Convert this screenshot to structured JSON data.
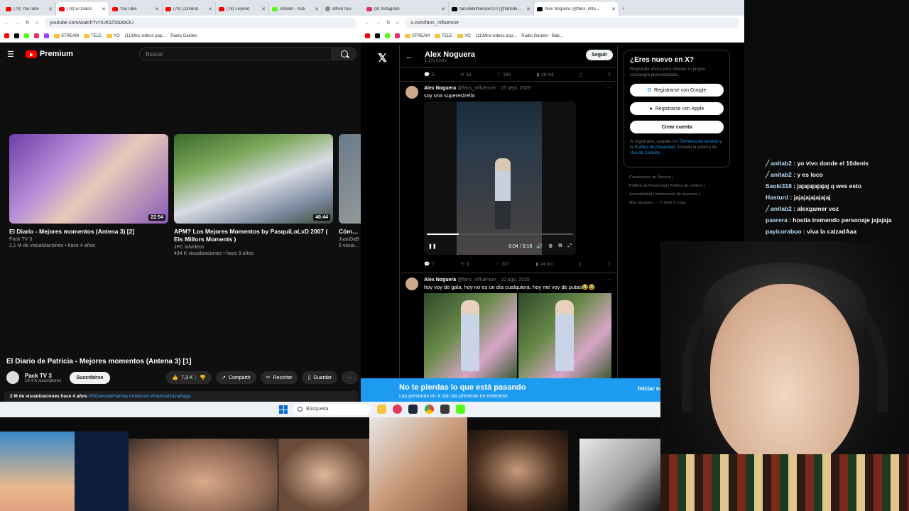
{
  "left_browser": {
    "tabs": [
      {
        "label": "(78) YouTube",
        "icon": "youtube"
      },
      {
        "label": "(78) El Diario",
        "icon": "youtube",
        "active": true
      },
      {
        "label": "YouTube",
        "icon": "youtube"
      },
      {
        "label": "(78) Comand",
        "icon": "youtube"
      },
      {
        "label": "(78) Leyend",
        "icon": "youtube"
      },
      {
        "label": "Stream - Kick",
        "icon": "kick"
      },
      {
        "label": "alfred neu",
        "icon": "globe"
      }
    ],
    "url": "youtube.com/watch?v=IUtOZSbAbOU",
    "bookmarks": [
      "STREAM",
      "TELE",
      "YO",
      "(11)Miru videos pop...",
      "Radio Garden"
    ],
    "header": {
      "logo": "Premium",
      "search_placeholder": "Buscar"
    },
    "end_cards": [
      {
        "title": "El Diario - Mejores momentos (Antena 3) [2]",
        "channel": "Pack TV 3",
        "meta": "2,1 M de visualizaciones • hace 4 años",
        "duration": "22:54"
      },
      {
        "title": "APM? Los Mejores Momentos by PasquiLoLxD 2007 ( Els Millors Moments )",
        "channel": "JPC lolvideos",
        "meta": "434 K visualizaciones • hace 9 años",
        "duration": "40:44"
      },
      {
        "title": "Cómo h Barriga",
        "channel": "JuanDaB",
        "meta": "5 visualiza",
        "duration": ""
      }
    ],
    "video": {
      "title": "El Diario de Patricia - Mejores momentos (Antena 3) [1]",
      "channel": "Pack TV 3",
      "subscribers": "19,4 K suscriptores",
      "subscribe_label": "Suscribirse",
      "likes": "7,3 K",
      "share_label": "Compartir",
      "clip_label": "Recortar",
      "save_label": "Guardar",
      "views": "2 M de visualizaciones  hace 4 años",
      "tags": "#ElDiariodePatricia #Antena3 #PatriciaGaztañaga"
    }
  },
  "right_browser": {
    "tabs": [
      {
        "label": "(9) Instagram"
      },
      {
        "label": "fansdelinfluencer3.0 (@fansde..."
      },
      {
        "label": "Alex Noguera (@fans_influ...",
        "active": true
      }
    ],
    "url": "x.com/fans_influencer",
    "bookmarks": [
      "STREAM",
      "TELE",
      "YO",
      "(11)Mira videos pop...",
      "Radio Garden - Bab..."
    ],
    "profile": {
      "name": "Alex Noguera",
      "posts": "1.211 posts",
      "follow_label": "Seguir"
    },
    "prev_actions": {
      "replies": "5",
      "reposts": "18",
      "likes": "342",
      "views": "28 mil"
    },
    "posts": [
      {
        "name": "Alex Noguera",
        "handle": "@fans_influencer · 15 sept. 2025",
        "text": "soy una superestrella",
        "time": "0:04 / 0:18",
        "progress": 0.22,
        "actions": {
          "replies": "7",
          "reposts": "9",
          "likes": "337",
          "views": "24 mil"
        }
      },
      {
        "name": "Alex Noguera",
        "handle": "@fans_influencer · 10 ago. 2025",
        "text": "hoy voy de gala, hoy no es un día cualquiera, hoy me voy de putas😂😂"
      }
    ],
    "aside": {
      "title": "¿Eres nuevo en X?",
      "desc": "Regístrate ahora para obtener tu propia cronología personalizada.",
      "google_label": "Registrarse con Google",
      "apple_label": "Registrarse con Apple",
      "create_label": "Crear cuenta",
      "legal_prefix": "Al registrarte, aceptas los ",
      "legal_terms": "Términos de servicio",
      "legal_mid": " y la ",
      "legal_privacy": "Política de privacidad",
      "legal_mid2": ", incluida la política de ",
      "legal_cookies": "Uso de Cookies",
      "legal_end": "."
    },
    "footer": [
      "Condiciones de Servicio",
      "Política de Privacidad",
      "Política de cookies",
      "Accesibilidad",
      "Información de anuncios",
      "Más opciones ···",
      "© 2026 X Corp."
    ],
    "banner": {
      "title": "No te pierdas lo que está pasando",
      "subtitle": "Las personas en X son las primeras en enterarse.",
      "button": "Iniciar se"
    }
  },
  "taskbar": {
    "search_placeholder": "Búsqueda"
  },
  "chat": [
    {
      "user": "anitab2",
      "message": "yo vivo donde el 10denis",
      "badge": true
    },
    {
      "user": "anitab2",
      "message": "y es loco",
      "badge": true
    },
    {
      "user": "Saoki318",
      "message": "jajajajajajaj q wes esto",
      "badge": false
    },
    {
      "user": "Hasturd",
      "message": "jajajajajajajaj",
      "badge": false
    },
    {
      "user": "anitab2",
      "message": "alexgamer voz",
      "badge": true
    },
    {
      "user": "paarera",
      "message": "hostia tremendo personaje jajajaja",
      "badge": false
    },
    {
      "user": "payicorabuo",
      "message": "viva la calzadAaa",
      "badge": false
    }
  ],
  "colors": {
    "youtube_red": "#ff0000",
    "x_blue": "#1d9bf0",
    "x_border": "#2f3336",
    "chat_user": "#b9e1ff"
  }
}
